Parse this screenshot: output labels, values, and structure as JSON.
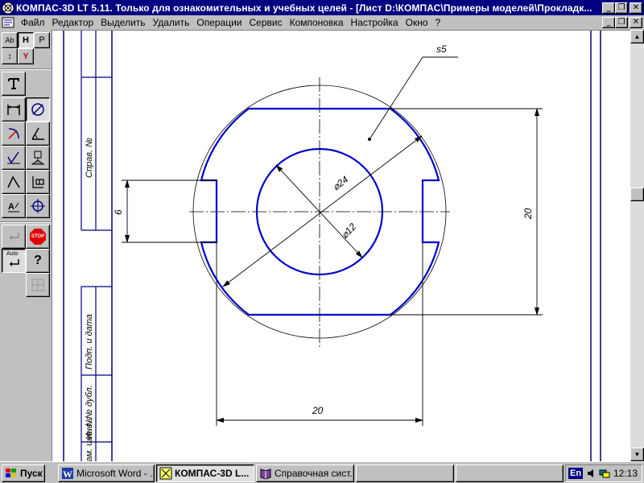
{
  "window": {
    "title": "КОМПАС-3D LT 5.11. Только для ознакомительных и учебных целей - [Лист D:\\КОМПАС\\Примеры моделей\\Прокладк...",
    "minimize_glyph": "_",
    "restore_glyph": "❐",
    "close_glyph": "✕"
  },
  "menu": {
    "items": [
      "Файл",
      "Редактор",
      "Выделить",
      "Удалить",
      "Операции",
      "Сервис",
      "Компоновка",
      "Настройка",
      "Окно",
      "?"
    ],
    "underlined_letters": [
      "Ф",
      "Р",
      "В",
      "У",
      "О",
      "С",
      "К",
      "Н",
      "О",
      "?"
    ]
  },
  "toolbar": {
    "top_row1": [
      "Ab",
      "H",
      "P"
    ],
    "top_row2": [
      "↕",
      "Y"
    ],
    "help_label": "?",
    "stop_label": "STOP",
    "auto_label": "Auto"
  },
  "drawing": {
    "surface_label": "s5",
    "dim_outer_diameter": "⌀24",
    "dim_inner_diameter": "⌀12",
    "dim_height": "20",
    "dim_width": "20",
    "dim_slot": "6",
    "frame_text_1": "Справ. №",
    "frame_text_2": "Подп. и дата",
    "frame_text_3": "Инв. № дубл.",
    "frame_text_4": "Взам. инв. №"
  },
  "taskbar": {
    "start_label": "Пуск",
    "tasks": [
      {
        "label": "Microsoft Word - ...",
        "active": false
      },
      {
        "label": "КОМПАС-3D L...",
        "active": true
      },
      {
        "label": "Справочная сист...",
        "active": false
      },
      {
        "label": "",
        "active": false
      },
      {
        "label": "",
        "active": false
      }
    ],
    "language": "En",
    "time": "12:13"
  },
  "colors": {
    "titlebar": "#000080",
    "drawing_line": "#0000cc",
    "dim_line": "#000000"
  }
}
